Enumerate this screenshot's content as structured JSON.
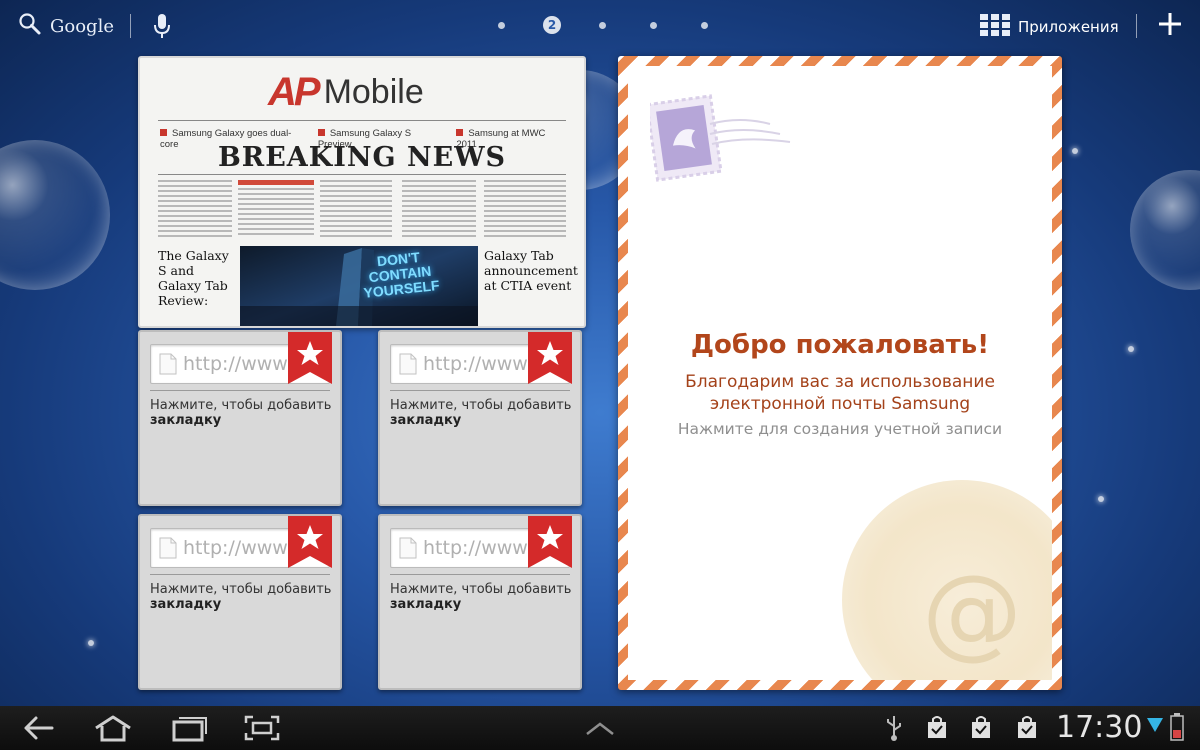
{
  "colors": {
    "accent": "#b2461b",
    "ribbon": "#d42a2a",
    "envelope_stripe": "#e8874e"
  },
  "topbar": {
    "search_label": "Google",
    "page_indicator": "2",
    "apps_label": "Приложения"
  },
  "ap_widget": {
    "logo_mark": "AP",
    "logo_text": "Mobile",
    "ticker": [
      "Samsung Galaxy goes dual-core",
      "Samsung Galaxy S Preview",
      "Samsung at MWC 2011"
    ],
    "headline": "BREAKING NEWS",
    "left_story": "The Galaxy S and Galaxy Tab Review:",
    "right_story": "Galaxy Tab announcement at CTIA event",
    "image_caption": "DON'T CONTAIN YOURSELF"
  },
  "bookmarks": [
    {
      "url_placeholder": "http://www",
      "line1": "Нажмите, чтобы добавить",
      "line2": "закладку"
    },
    {
      "url_placeholder": "http://www",
      "line1": "Нажмите, чтобы добавить",
      "line2": "закладку"
    },
    {
      "url_placeholder": "http://www",
      "line1": "Нажмите, чтобы добавить",
      "line2": "закладку"
    },
    {
      "url_placeholder": "http://www",
      "line1": "Нажмите, чтобы добавить",
      "line2": "закладку"
    }
  ],
  "email_widget": {
    "title": "Добро пожаловать!",
    "subtitle_line1": "Благодарим вас за использование",
    "subtitle_line2": "электронной почты Samsung",
    "hint": "Нажмите для создания учетной записи"
  },
  "statusbar": {
    "clock": "17:30"
  },
  "icons": [
    "search-icon",
    "mic-icon",
    "apps-grid-icon",
    "plus-icon",
    "star-ribbon-icon",
    "page-icon",
    "back-icon",
    "home-icon",
    "recent-apps-icon",
    "screenshot-icon",
    "up-chevron-icon",
    "usb-icon",
    "bag-icon",
    "bag-check-icon",
    "wifi-icon",
    "battery-icon",
    "stamp-icon"
  ]
}
